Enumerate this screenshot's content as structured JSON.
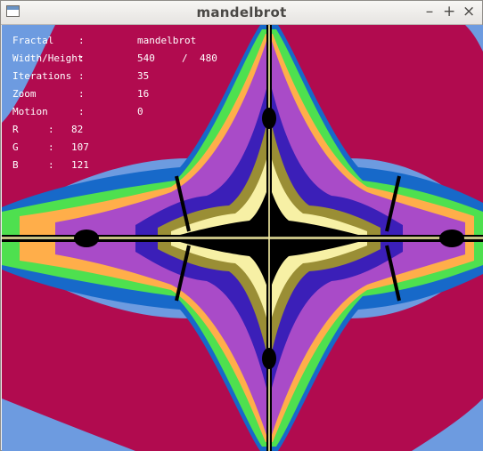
{
  "window": {
    "title": "mandelbrot",
    "controls": [
      "–",
      "+",
      "×"
    ]
  },
  "info": {
    "fractal": {
      "label": "Fractal",
      "sep": ":",
      "value": "mandelbrot"
    },
    "size": {
      "label": "Width/Height",
      "sep": ":",
      "width": "540",
      "slash": "/",
      "height": "480"
    },
    "iterations": {
      "label": "Iterations",
      "sep": ":",
      "value": "35"
    },
    "zoom": {
      "label": "Zoom",
      "sep": ":",
      "value": "16"
    },
    "motion": {
      "label": "Motion",
      "sep": ":",
      "value": "0"
    },
    "r": {
      "label": "R",
      "sep": ":",
      "value": "82"
    },
    "g": {
      "label": "G",
      "sep": ":",
      "value": "107"
    },
    "b": {
      "label": "B",
      "sep": ":",
      "value": "121"
    }
  },
  "palette": {
    "sky": "#6d9be0",
    "crimson": "#b10b4f",
    "blue": "#1769c9",
    "green": "#4ee04f",
    "orange": "#ffae4a",
    "violet": "#a94bc8",
    "indigo": "#3b1fb8",
    "olive": "#9a8e35",
    "cream": "#f7f0a5",
    "mint": "#9fd08c",
    "core": "#000000"
  }
}
